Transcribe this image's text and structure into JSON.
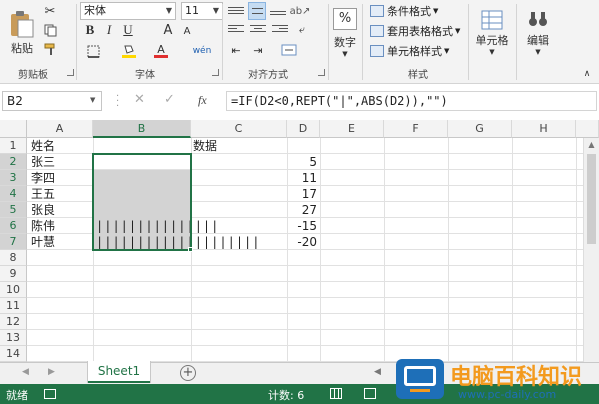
{
  "ribbon": {
    "clipboard": {
      "paste_label": "粘贴",
      "group_label": "剪贴板"
    },
    "font": {
      "font_name": "宋体",
      "font_size": "11",
      "bold": "B",
      "italic": "I",
      "underline": "U",
      "grow_font": "A",
      "shrink_font": "A",
      "font_color_glyph": "A",
      "phonetic_glyph": "wén",
      "group_label": "字体"
    },
    "alignment": {
      "group_label": "对齐方式"
    },
    "number": {
      "label": "数字",
      "glyph": "%"
    },
    "styles": {
      "conditional_format": "条件格式",
      "table_format": "套用表格格式",
      "cell_styles": "单元格样式",
      "group_label": "样式"
    },
    "cells": {
      "label": "单元格"
    },
    "editing": {
      "label": "编辑"
    }
  },
  "formula_bar": {
    "name_box": "B2",
    "fx": "fx",
    "formula": "=IF(D2<0,REPT(\"|\",ABS(D2)),\"\")"
  },
  "grid": {
    "columns": [
      "A",
      "B",
      "C",
      "D",
      "E",
      "F",
      "G",
      "H"
    ],
    "rows": [
      "1",
      "2",
      "3",
      "4",
      "5",
      "6",
      "7",
      "8",
      "9",
      "10",
      "11",
      "12",
      "13",
      "14"
    ],
    "header_a": "姓名",
    "header_c": "数据",
    "names": [
      "张三",
      "李四",
      "王五",
      "张良",
      "陈伟",
      "叶慧"
    ],
    "values": [
      "5",
      "11",
      "17",
      "27",
      "-15",
      "-20"
    ],
    "bars_row6": "|||||||||||||||",
    "bars_row7": "||||||||||||||||||||"
  },
  "sheet_tabs": {
    "active": "Sheet1",
    "add_glyph": "+"
  },
  "status_bar": {
    "mode": "就绪",
    "count": "计数: 6"
  },
  "watermark": {
    "title": "电脑百科知识",
    "url": "www.pc-daily.com"
  },
  "colors": {
    "accent": "#217346",
    "selection_fill": "#d3d3d3",
    "watermark_orange": "#f39a1e",
    "watermark_blue": "#1e6fb8"
  }
}
